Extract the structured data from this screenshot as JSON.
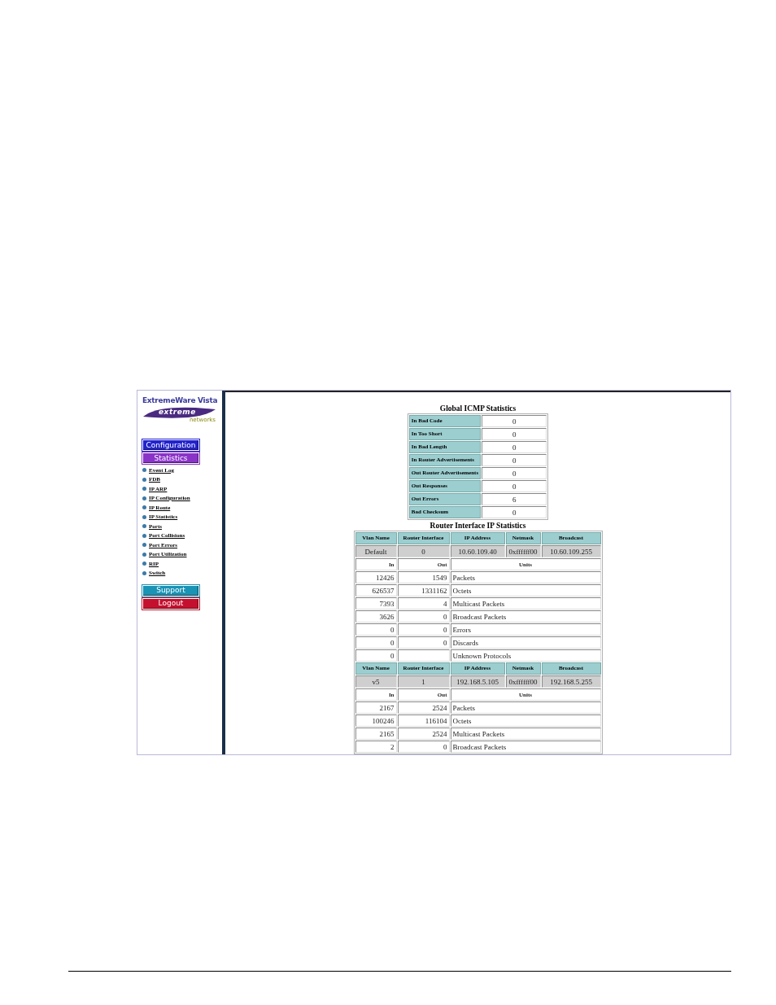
{
  "sidebar": {
    "title": "ExtremeWare Vista",
    "logo": {
      "name": "extreme",
      "tagline": "networks"
    },
    "nav_buttons": [
      {
        "label": "Configuration",
        "color": "#2222cc"
      },
      {
        "label": "Statistics",
        "color": "#8a33c8"
      }
    ],
    "links": [
      "Event Log",
      "FDB",
      "IP ARP",
      "IP Configuration",
      "IP Route",
      "IP Statistics",
      "Ports",
      "Port Collisions",
      "Port Errors",
      "Port Utilization",
      "RIP",
      "Switch"
    ],
    "bottom_buttons": [
      {
        "label": "Support",
        "color": "#1a93b5"
      },
      {
        "label": "Logout",
        "color": "#c4102e"
      }
    ]
  },
  "icmp": {
    "title": "Global ICMP Statistics",
    "rows": [
      {
        "label": "In Bad Code",
        "value": "0"
      },
      {
        "label": "In Too Short",
        "value": "0"
      },
      {
        "label": "In Bad Length",
        "value": "0"
      },
      {
        "label": "In Router Advertisements",
        "value": "0"
      },
      {
        "label": "Out Router Advertisements",
        "value": "0"
      },
      {
        "label": "Out Responses",
        "value": "0"
      },
      {
        "label": "Out Errors",
        "value": "6"
      },
      {
        "label": "Bad Checksum",
        "value": "0"
      }
    ]
  },
  "router": {
    "title": "Router Interface IP Statistics",
    "blocks": [
      {
        "columns": [
          "Vlan Name",
          "Router Interface",
          "IP Address",
          "Netmask",
          "Broadcast"
        ],
        "values": [
          "Default",
          "0",
          "10.60.109.40",
          "0xffffff00",
          "10.60.109.255"
        ],
        "subheader": [
          "In",
          "Out",
          "Units"
        ],
        "rows": [
          {
            "in": "12426",
            "out": "1549",
            "units": "Packets"
          },
          {
            "in": "626537",
            "out": "1331162",
            "units": "Octets"
          },
          {
            "in": "7393",
            "out": "4",
            "units": "Multicast Packets"
          },
          {
            "in": "3626",
            "out": "0",
            "units": "Broadcast Packets"
          },
          {
            "in": "0",
            "out": "0",
            "units": "Errors"
          },
          {
            "in": "0",
            "out": "0",
            "units": "Discards"
          },
          {
            "in": "0",
            "out": "",
            "units": "Unknown Protocols"
          }
        ]
      },
      {
        "columns": [
          "Vlan Name",
          "Router Interface",
          "IP Address",
          "Netmask",
          "Broadcast"
        ],
        "values": [
          "v5",
          "1",
          "192.168.5.105",
          "0xffffff00",
          "192.168.5.255"
        ],
        "subheader": [
          "In",
          "Out",
          "Units"
        ],
        "rows": [
          {
            "in": "2167",
            "out": "2524",
            "units": "Packets"
          },
          {
            "in": "100246",
            "out": "116104",
            "units": "Octets"
          },
          {
            "in": "2165",
            "out": "2524",
            "units": "Multicast Packets"
          },
          {
            "in": "2",
            "out": "0",
            "units": "Broadcast Packets"
          }
        ]
      }
    ]
  }
}
